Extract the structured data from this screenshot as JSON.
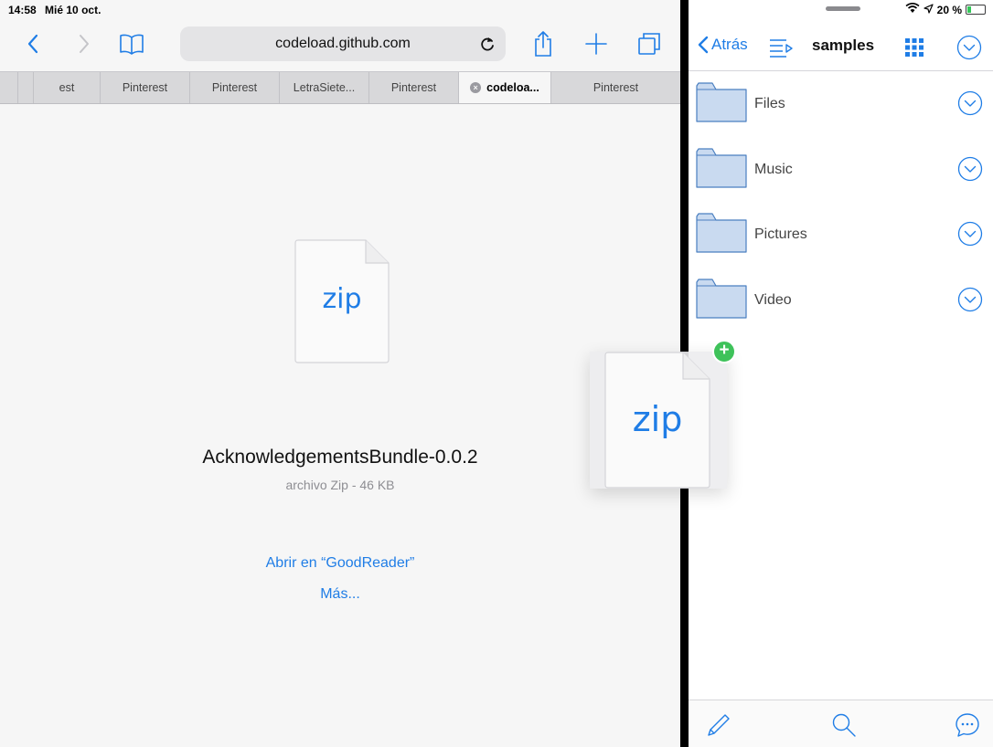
{
  "status_bar": {
    "time": "14:58",
    "date": "Mié 10 oct.",
    "battery": "20 %",
    "battery_level": 0.2
  },
  "safari": {
    "url": "codeload.github.com",
    "tabs": [
      {
        "label": "est",
        "active": false
      },
      {
        "label": "Pinterest",
        "active": false
      },
      {
        "label": "Pinterest",
        "active": false
      },
      {
        "label": "LetraSiete...",
        "active": false
      },
      {
        "label": "Pinterest",
        "active": false
      },
      {
        "label": "codeloa...",
        "active": true
      },
      {
        "label": "Pinterest",
        "active": false
      }
    ],
    "download": {
      "icon_label": "zip",
      "file_name": "AcknowledgementsBundle-0.0.2",
      "file_meta": "archivo Zip - 46 KB",
      "open_in_label": "Abrir en “GoodReader”",
      "more_label": "Más..."
    }
  },
  "goodreader": {
    "back_label": "Atrás",
    "title": "samples",
    "folders": [
      "Files",
      "Music",
      "Pictures",
      "Video"
    ]
  },
  "drag_preview": {
    "icon_label": "zip",
    "badge": "+"
  },
  "colors": {
    "accent": "#1f7de6",
    "folder_fill": "#c9daf0",
    "folder_stroke": "#4a7fc0",
    "badge_green": "#3ec25a"
  }
}
